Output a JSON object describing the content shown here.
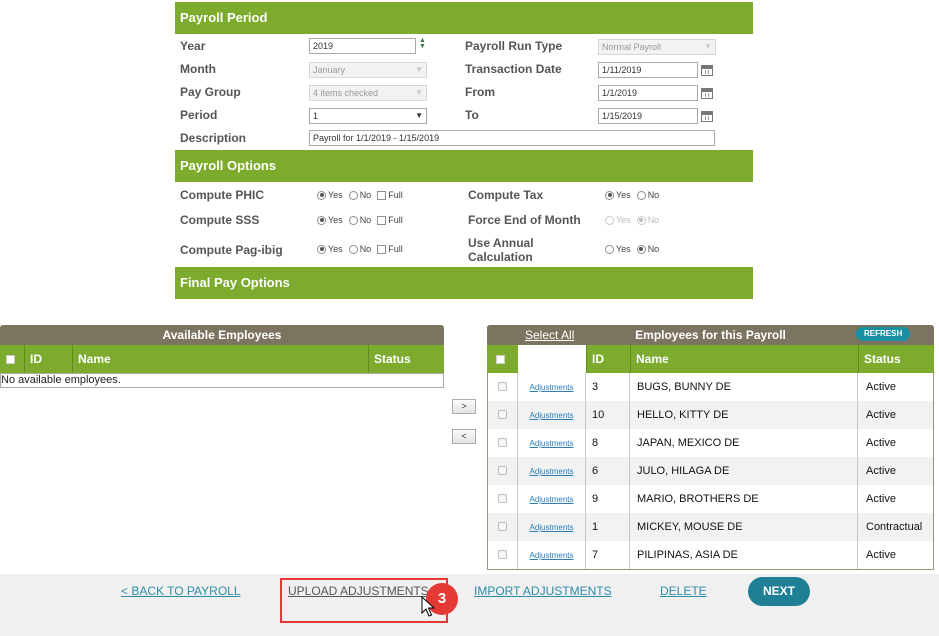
{
  "payroll_period": {
    "header": "Payroll Period",
    "year_label": "Year",
    "year_value": "2019",
    "month_label": "Month",
    "month_value": "January",
    "pay_group_label": "Pay Group",
    "pay_group_value": "4 items checked",
    "period_label": "Period",
    "period_value": "1",
    "description_label": "Description",
    "description_value": "Payroll for 1/1/2019 - 1/15/2019",
    "run_type_label": "Payroll Run Type",
    "run_type_value": "Normal Payroll",
    "transaction_date_label": "Transaction Date",
    "transaction_date_value": "1/11/2019",
    "from_label": "From",
    "from_value": "1/1/2019",
    "to_label": "To",
    "to_value": "1/15/2019"
  },
  "payroll_options": {
    "header": "Payroll Options",
    "phic_label": "Compute PHIC",
    "sss_label": "Compute SSS",
    "pagibig_label": "Compute Pag-ibig",
    "tax_label": "Compute Tax",
    "force_eom_label": "Force End of Month",
    "annual_label_1": "Use Annual",
    "annual_label_2": "Calculation",
    "yes": "Yes",
    "no": "No",
    "full": "Full"
  },
  "final_pay": {
    "header": "Final Pay Options"
  },
  "available": {
    "title": "Available Employees",
    "columns": {
      "id": "ID",
      "name": "Name",
      "status": "Status"
    },
    "empty_message": "No available employees."
  },
  "transfer": {
    "add": ">",
    "remove": "<"
  },
  "payroll_employees": {
    "select_all": "Select All",
    "title": "Employees for this Payroll",
    "refresh": "REFRESH",
    "columns": {
      "id": "ID",
      "name": "Name",
      "status": "Status"
    },
    "adjustments_label": "Adjustments",
    "rows": [
      {
        "id": "3",
        "name": "BUGS, BUNNY DE",
        "status": "Active"
      },
      {
        "id": "10",
        "name": "HELLO, KITTY DE",
        "status": "Active"
      },
      {
        "id": "8",
        "name": "JAPAN, MEXICO DE",
        "status": "Active"
      },
      {
        "id": "6",
        "name": "JULO, HILAGA DE",
        "status": "Active"
      },
      {
        "id": "9",
        "name": "MARIO, BROTHERS DE",
        "status": "Active"
      },
      {
        "id": "1",
        "name": "MICKEY, MOUSE DE",
        "status": "Contractual"
      },
      {
        "id": "7",
        "name": "PILIPINAS, ASIA DE",
        "status": "Active"
      }
    ]
  },
  "footer": {
    "back": "< BACK TO PAYROLL",
    "upload": "UPLOAD ADJUSTMENTS",
    "import": "IMPORT ADJUSTMENTS",
    "delete": "DELETE",
    "next": "NEXT"
  },
  "annotation": {
    "step": "3",
    "color": "#e53935"
  },
  "colors": {
    "green_header": "#7cab2e",
    "panel_title": "#7b7461",
    "accent": "#1f7f95"
  }
}
